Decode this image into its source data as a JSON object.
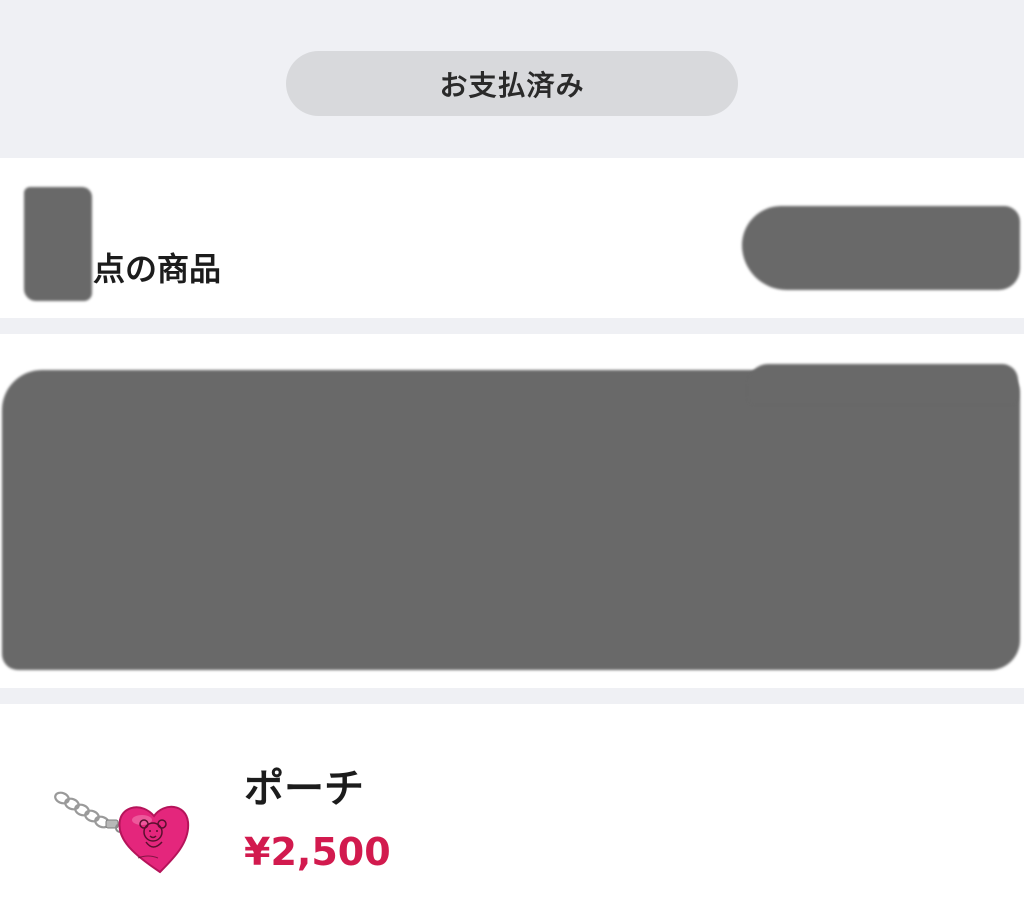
{
  "order": {
    "status_label": "お支払済み",
    "items_count_suffix": "点の商品"
  },
  "product": {
    "name": "ポーチ",
    "price": "¥2,500",
    "thumbnail": "heart-keychain-pouch"
  },
  "colors": {
    "price": "#d21a4e",
    "background_band": "#eff0f4",
    "redaction": "#696969"
  }
}
